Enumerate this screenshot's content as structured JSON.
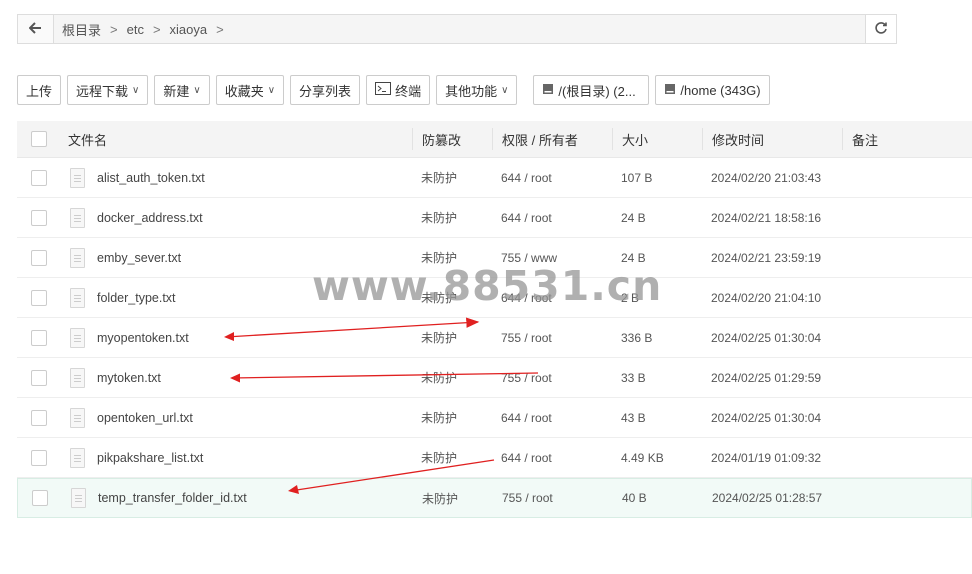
{
  "breadcrumb": {
    "items": [
      "根目录",
      "etc",
      "xiaoya"
    ],
    "separator": ">"
  },
  "toolbar": {
    "upload": "上传",
    "remote_download": "远程下载",
    "new": "新建",
    "favorites": "收藏夹",
    "share_list": "分享列表",
    "terminal": "终端",
    "other_functions": "其他功能",
    "disk_root": "/(根目录) (2...",
    "disk_home": "/home (343G)"
  },
  "table": {
    "headers": {
      "name": "文件名",
      "protect": "防篡改",
      "perm": "权限 / 所有者",
      "size": "大小",
      "mtime": "修改时间",
      "note": "备注"
    },
    "rows": [
      {
        "name": "alist_auth_token.txt",
        "protect": "未防护",
        "perm": "644 / root",
        "size": "107 B",
        "mtime": "2024/02/20 21:03:43"
      },
      {
        "name": "docker_address.txt",
        "protect": "未防护",
        "perm": "644 / root",
        "size": "24 B",
        "mtime": "2024/02/21 18:58:16"
      },
      {
        "name": "emby_sever.txt",
        "protect": "未防护",
        "perm": "755 / www",
        "size": "24 B",
        "mtime": "2024/02/21 23:59:19"
      },
      {
        "name": "folder_type.txt",
        "protect": "未防护",
        "perm": "644 / root",
        "size": "2 B",
        "mtime": "2024/02/20 21:04:10"
      },
      {
        "name": "myopentoken.txt",
        "protect": "未防护",
        "perm": "755 / root",
        "size": "336 B",
        "mtime": "2024/02/25 01:30:04"
      },
      {
        "name": "mytoken.txt",
        "protect": "未防护",
        "perm": "755 / root",
        "size": "33 B",
        "mtime": "2024/02/25 01:29:59"
      },
      {
        "name": "opentoken_url.txt",
        "protect": "未防护",
        "perm": "644 / root",
        "size": "43 B",
        "mtime": "2024/02/25 01:30:04"
      },
      {
        "name": "pikpakshare_list.txt",
        "protect": "未防护",
        "perm": "644 / root",
        "size": "4.49 KB",
        "mtime": "2024/01/19 01:09:32"
      },
      {
        "name": "temp_transfer_folder_id.txt",
        "protect": "未防护",
        "perm": "755 / root",
        "size": "40 B",
        "mtime": "2024/02/25 01:28:57"
      }
    ]
  },
  "watermark": "www.88531.cn",
  "colors": {
    "highlight_row": "#f2faf7",
    "arrow": "#e02020",
    "header_bg": "#f4f4f4"
  }
}
